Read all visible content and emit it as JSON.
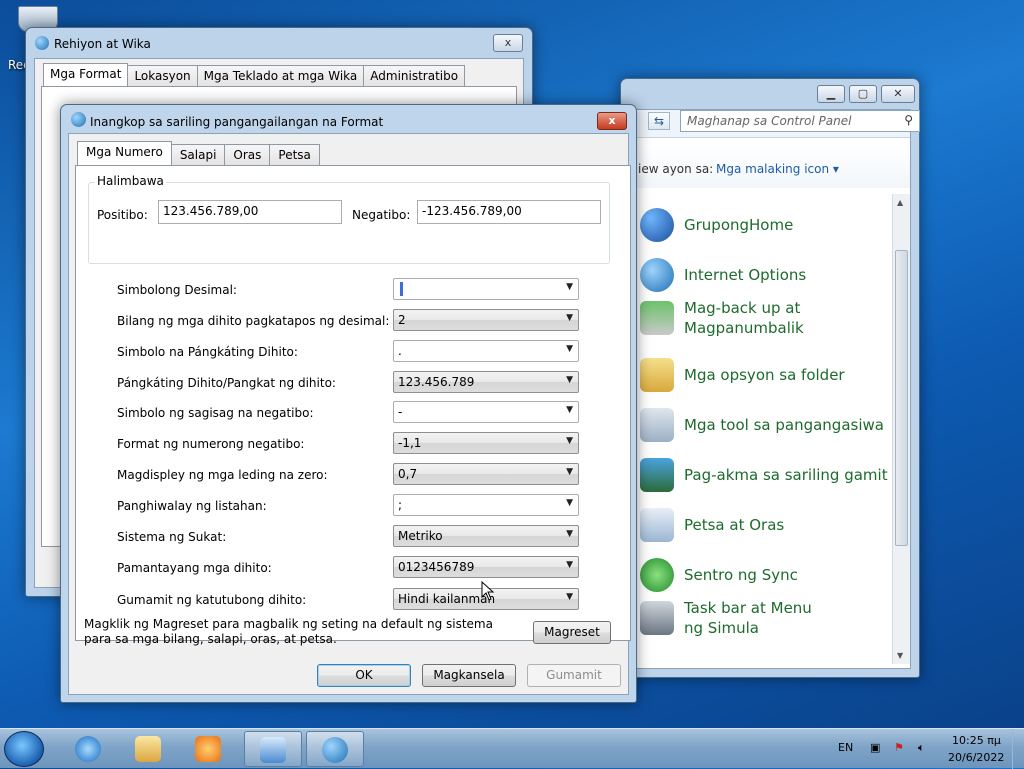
{
  "desktop": {
    "recycle_label": "Rec"
  },
  "region_window": {
    "title": "Rehiyon at Wika",
    "tabs": [
      "Mga Format",
      "Lokasyon",
      "Mga Teklado at mga Wika",
      "Administratibo"
    ],
    "close_label": "x"
  },
  "control_panel": {
    "search_placeholder": "Maghanap sa Control Panel",
    "view_by_label": "iew ayon sa:",
    "view_by_value": "Mga malaking icon",
    "items": [
      {
        "label": "GrupongHome",
        "icon": "homegroup-icon"
      },
      {
        "label": "Internet Options",
        "icon": "internet-options-icon"
      },
      {
        "label": "Mag-back up at Magpanumbalik",
        "icon": "backup-icon"
      },
      {
        "label": "Mga opsyon sa folder",
        "icon": "folder-options-icon"
      },
      {
        "label": "Mga tool sa pangangasiwa",
        "icon": "admin-tools-icon"
      },
      {
        "label": "Pag-akma sa sariling gamit",
        "icon": "personalization-icon"
      },
      {
        "label": "Petsa at Oras",
        "icon": "date-time-icon"
      },
      {
        "label": "Sentro ng Sync",
        "icon": "sync-center-icon"
      },
      {
        "label": "Task bar at Menu ng Simula",
        "icon": "taskbar-menu-icon"
      }
    ]
  },
  "customize_dialog": {
    "title": "Inangkop sa sariling pangangailangan na Format",
    "tabs": [
      "Mga Numero",
      "Salapi",
      "Oras",
      "Petsa"
    ],
    "example": {
      "group_title": "Halimbawa",
      "positive_label": "Positibo:",
      "positive_value": "123.456.789,00",
      "negative_label": "Negatibo:",
      "negative_value": "-123.456.789,00"
    },
    "settings": [
      {
        "label": "Simbolong Desimal:",
        "value": "",
        "style": "edit"
      },
      {
        "label": "Bilang ng mga dihito pagkatapos ng desimal:",
        "value": "2",
        "style": "dropdown"
      },
      {
        "label": "Simbolo na Pángkáting Dihito:",
        "value": ".",
        "style": "edit"
      },
      {
        "label": "Pángkáting Dihito/Pangkat ng dihito:",
        "value": "123.456.789",
        "style": "dropdown"
      },
      {
        "label": "Simbolo ng sagisag na negatibo:",
        "value": "-",
        "style": "edit"
      },
      {
        "label": "Format ng numerong negatibo:",
        "value": "-1,1",
        "style": "dropdown"
      },
      {
        "label": "Magdispley ng mga leding na zero:",
        "value": "0,7",
        "style": "dropdown"
      },
      {
        "label": "Panghiwalay ng listahan:",
        "value": ";",
        "style": "edit"
      },
      {
        "label": "Sistema ng Sukat:",
        "value": "Metriko",
        "style": "dropdown"
      },
      {
        "label": "Pamantayang mga dihito:",
        "value": "0123456789",
        "style": "dropdown"
      },
      {
        "label": "Gumamit ng katutubong dihito:",
        "value": "Hindi kailanman",
        "style": "dropdown"
      }
    ],
    "reset_note": "Magklik ng Magreset para magbalik ng seting na default ng sistema para sa mga bilang, salapi, oras, at petsa.",
    "reset_button": "Magreset",
    "ok_button": "OK",
    "cancel_button": "Magkansela",
    "apply_button": "Gumamit",
    "close_label": "x"
  },
  "taskbar": {
    "language": "EN",
    "time": "10:25 πμ",
    "date": "20/6/2022"
  }
}
